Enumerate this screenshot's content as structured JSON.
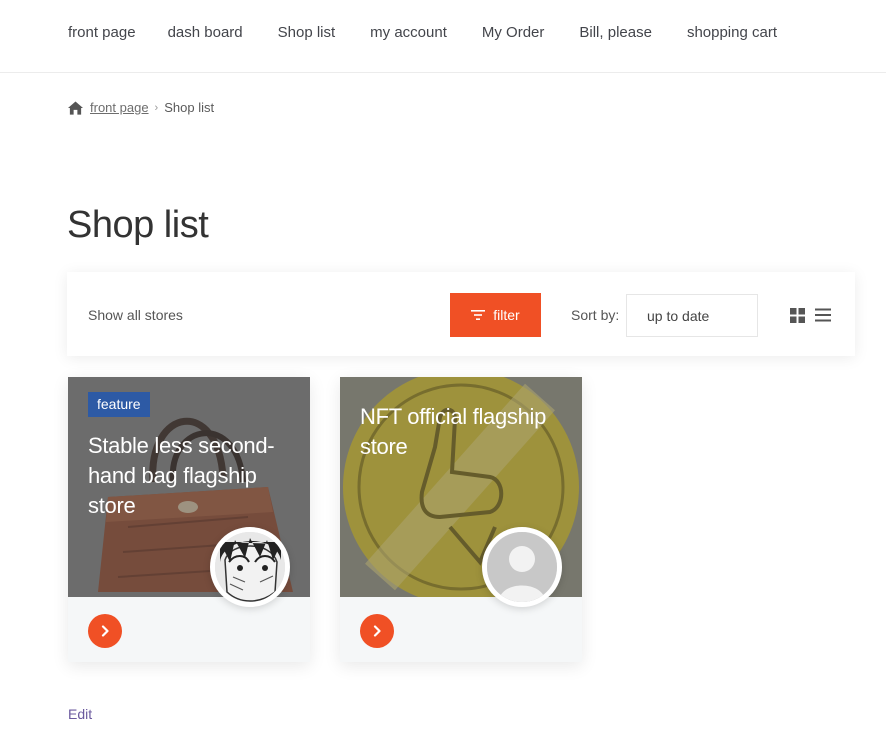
{
  "nav": {
    "items": [
      "front page",
      "dash board",
      "Shop list",
      "my account",
      "My Order",
      "Bill, please",
      "shopping cart"
    ]
  },
  "breadcrumb": {
    "home_icon": "home-icon",
    "home_label": "front page",
    "current": "Shop list"
  },
  "page": {
    "title": "Shop list"
  },
  "toolbar": {
    "show_all_label": "Show all stores",
    "filter_label": "filter",
    "filter_icon": "filter-icon",
    "sort_label": "Sort by:",
    "sort_value": "up to date",
    "view_icons": [
      "grid-view-icon",
      "list-view-icon"
    ]
  },
  "stores": [
    {
      "badge": "feature",
      "name": "Stable less second-hand bag flagship store",
      "banner_icon": "handbag-image",
      "avatar_icon": "anime-avatar"
    },
    {
      "badge": "",
      "name": "NFT official flagship store",
      "banner_icon": "nft-coin-image",
      "avatar_icon": "default-user-avatar"
    }
  ],
  "colors": {
    "accent": "#f05025",
    "badge": "#2d5aa5",
    "link": "#6b5a9e"
  },
  "footer": {
    "edit_label": "Edit"
  }
}
